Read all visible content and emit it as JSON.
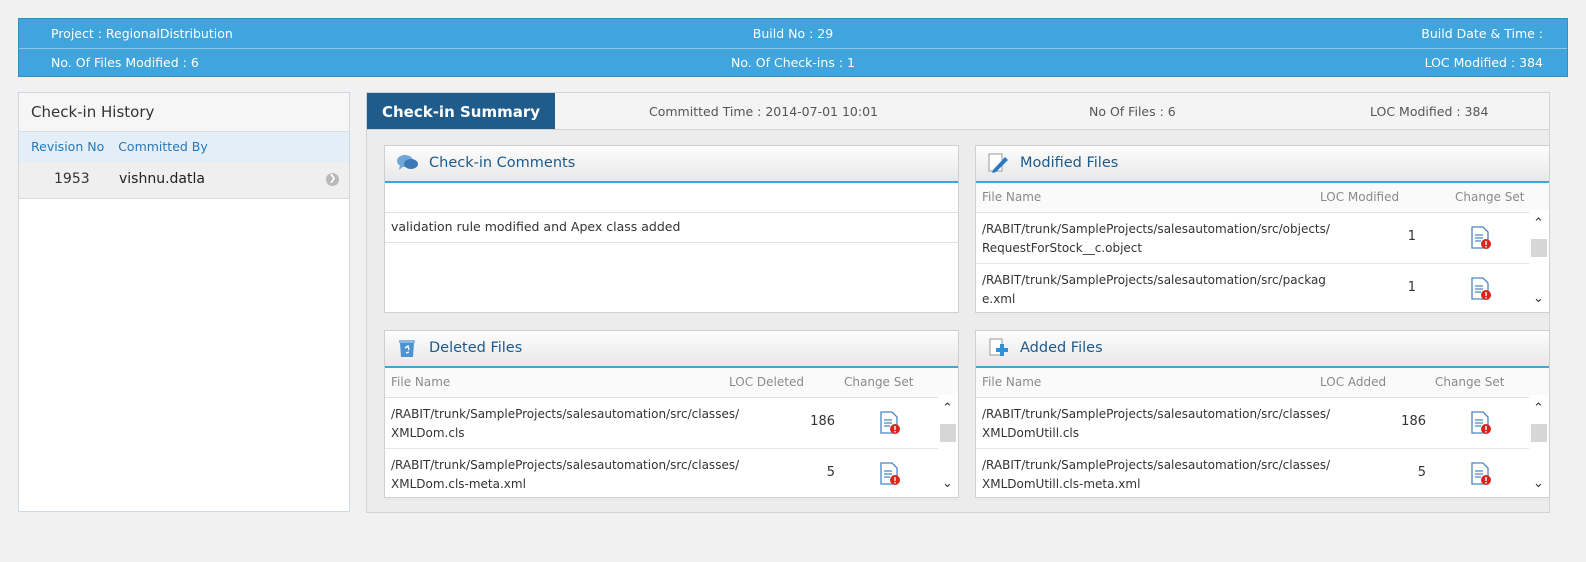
{
  "topbar": {
    "project": "Project : RegionalDistribution",
    "build_no": "Build No : 29",
    "build_date": "Build Date & Time :",
    "files_modified": "No. Of Files Modified : 6",
    "checkins": "No. Of Check-ins : 1",
    "loc_modified": "LOC Modified : 384"
  },
  "history": {
    "title": "Check-in History",
    "col_revision": "Revision No",
    "col_committer": "Committed By",
    "entries": [
      {
        "revision": "1953",
        "user": "vishnu.datla"
      }
    ]
  },
  "summary": {
    "tab": "Check-in Summary",
    "committed_time": "Committed Time : 2014-07-01 10:01",
    "no_of_files": "No Of Files : 6",
    "loc_modified": "LOC Modified : 384"
  },
  "comments": {
    "title": "Check-in Comments",
    "text": "validation rule modified and Apex class added"
  },
  "modified": {
    "title": "Modified Files",
    "col_file": "File Name",
    "col_loc": "LOC Modified",
    "col_cs": "Change Set",
    "rows": [
      {
        "path": "/RABIT/trunk/SampleProjects/salesautomation/src/objects/RequestForStock__c.object",
        "loc": "1"
      },
      {
        "path": "/RABIT/trunk/SampleProjects/salesautomation/src/package.xml",
        "loc": "1"
      }
    ]
  },
  "deleted": {
    "title": "Deleted Files",
    "col_file": "File Name",
    "col_loc": "LOC Deleted",
    "col_cs": "Change Set",
    "rows": [
      {
        "path": "/RABIT/trunk/SampleProjects/salesautomation/src/classes/XMLDom.cls",
        "loc": "186"
      },
      {
        "path": "/RABIT/trunk/SampleProjects/salesautomation/src/classes/XMLDom.cls-meta.xml",
        "loc": "5"
      }
    ]
  },
  "added": {
    "title": "Added Files",
    "col_file": "File Name",
    "col_loc": "LOC Added",
    "col_cs": "Change Set",
    "rows": [
      {
        "path": "/RABIT/trunk/SampleProjects/salesautomation/src/classes/XMLDomUtill.cls",
        "loc": "186"
      },
      {
        "path": "/RABIT/trunk/SampleProjects/salesautomation/src/classes/XMLDomUtill.cls-meta.xml",
        "loc": "5"
      }
    ]
  },
  "icons": {
    "comments": "speech-bubbles-icon",
    "modified": "pencil-document-icon",
    "deleted": "recycle-bin-icon",
    "added": "add-document-icon",
    "change_set": "document-alert-icon",
    "row_arrow": "chevron-right-icon",
    "scroll_up": "chevron-up-icon",
    "scroll_down": "chevron-down-icon"
  },
  "colors": {
    "accent": "#3fa5dc",
    "tab": "#1f5c8c",
    "heading": "#1d5a8c",
    "alert": "#d9261c"
  }
}
